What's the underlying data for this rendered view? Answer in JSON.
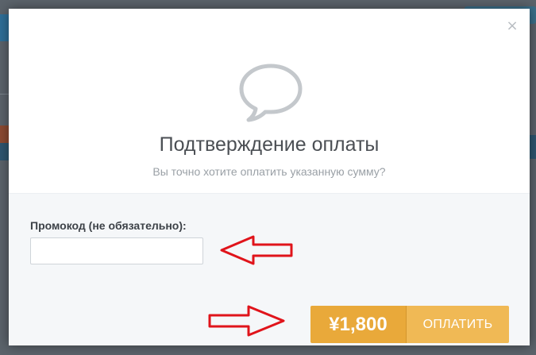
{
  "modal": {
    "close_symbol": "×",
    "icon": "speech-bubble-icon",
    "title": "Подтверждение оплаты",
    "subtitle": "Вы точно хотите оплатить указанную сумму?",
    "promo": {
      "label": "Промокод (не обязательно):",
      "value": "",
      "placeholder": ""
    },
    "pay_button": {
      "price": "¥1,800",
      "label": "ОПЛАТИТЬ"
    }
  },
  "colors": {
    "accent_dark": "#e9a93a",
    "accent_light": "#f0b955",
    "annotation_arrow": "#e0141b",
    "overlay": "#5b636b"
  }
}
